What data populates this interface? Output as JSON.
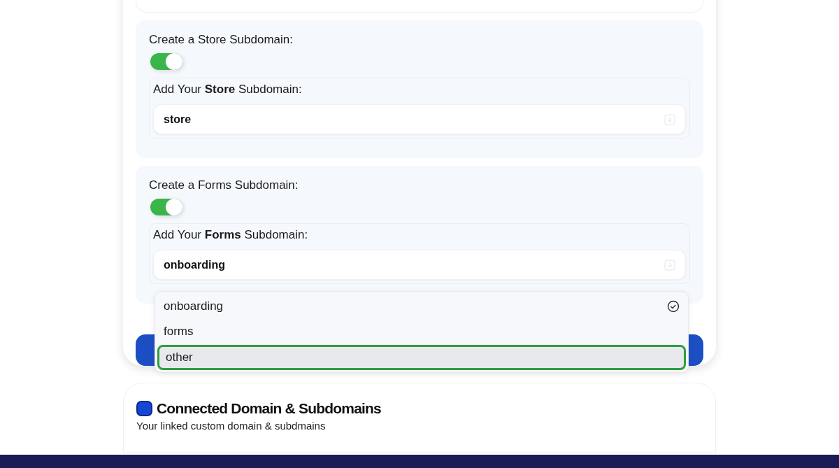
{
  "sections": [
    {
      "toggle_label": "Create a Store Subdomain:",
      "on": true,
      "field_label": "Add Your **Store** Subdomain:",
      "value": "store"
    },
    {
      "toggle_label": "Create a Forms Subdomain:",
      "on": true,
      "field_label": "Add Your **Forms** Subdomain:",
      "value": "onboarding"
    }
  ],
  "dropdown": {
    "options": [
      {
        "label": "onboarding",
        "selected": true,
        "highlighted": false
      },
      {
        "label": "forms",
        "selected": false,
        "highlighted": false
      },
      {
        "label": "other",
        "selected": false,
        "highlighted": true
      }
    ]
  },
  "connected": {
    "title": "Connected Domain & Subdomains",
    "subtitle": "Your linked custom domain & subdmains"
  }
}
